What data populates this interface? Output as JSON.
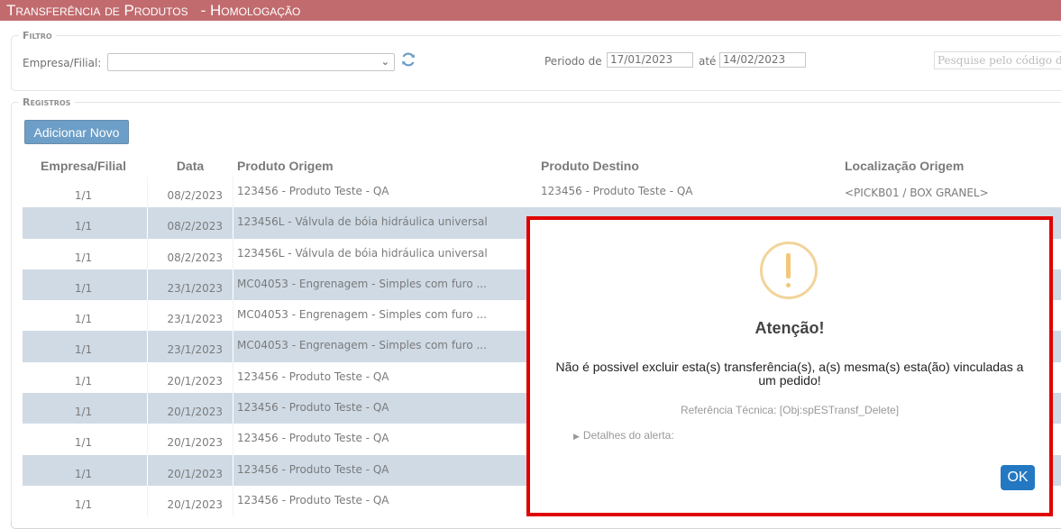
{
  "header": {
    "title": "Transferência de Produtos",
    "environment": "- Homologação"
  },
  "filtro": {
    "legend": "Filtro",
    "empresa_label": "Empresa/Filial:",
    "empresa_value": "",
    "periodo_label": "Periodo de",
    "periodo_start": "17/01/2023",
    "ate_label": "até",
    "periodo_end": "14/02/2023",
    "search_placeholder": "Pesquise pelo código d"
  },
  "registros": {
    "legend": "Registros",
    "add_button": "Adicionar Novo",
    "columns": [
      "Empresa/Filial",
      "Data",
      "Produto Origem",
      "Produto Destino",
      "Localização Origem"
    ],
    "rows": [
      {
        "empresa": "1/1",
        "data": "08/2/2023",
        "origem": "123456 - Produto Teste - QA",
        "destino": "123456 - Produto Teste - QA",
        "localizacao": "<PICKB01 / BOX GRANEL>"
      },
      {
        "empresa": "1/1",
        "data": "08/2/2023",
        "origem": "123456L - Válvula de bóia hidráulica universal",
        "destino": "",
        "localizacao": ""
      },
      {
        "empresa": "1/1",
        "data": "08/2/2023",
        "origem": "123456L - Válvula de bóia hidráulica universal",
        "destino": "",
        "localizacao": ""
      },
      {
        "empresa": "1/1",
        "data": "23/1/2023",
        "origem": "MC04053 - Engrenagem - Simples com furo ...",
        "destino": "",
        "localizacao": ""
      },
      {
        "empresa": "1/1",
        "data": "23/1/2023",
        "origem": "MC04053 - Engrenagem - Simples com furo ...",
        "destino": "",
        "localizacao": ""
      },
      {
        "empresa": "1/1",
        "data": "23/1/2023",
        "origem": "MC04053 - Engrenagem - Simples com furo ...",
        "destino": "",
        "localizacao": ""
      },
      {
        "empresa": "1/1",
        "data": "20/1/2023",
        "origem": "123456 - Produto Teste - QA",
        "destino": "",
        "localizacao": ""
      },
      {
        "empresa": "1/1",
        "data": "20/1/2023",
        "origem": "123456 - Produto Teste - QA",
        "destino": "",
        "localizacao": ""
      },
      {
        "empresa": "1/1",
        "data": "20/1/2023",
        "origem": "123456 - Produto Teste - QA",
        "destino": "",
        "localizacao": ""
      },
      {
        "empresa": "1/1",
        "data": "20/1/2023",
        "origem": "123456 - Produto Teste - QA",
        "destino": "",
        "localizacao": ""
      },
      {
        "empresa": "1/1",
        "data": "20/1/2023",
        "origem": "123456 - Produto Teste - QA",
        "destino": "",
        "localizacao": ""
      }
    ]
  },
  "modal": {
    "icon": "warning-icon",
    "title": "Atenção!",
    "message": "Não é possivel excluir esta(s) transferência(s), a(s) mesma(s) esta(ão) vinculadas a um pedido!",
    "reference": "Referência Técnica: [Obj:spESTransf_Delete]",
    "details_label": "Detalhes do alerta:",
    "ok_button": "OK"
  },
  "colors": {
    "header_bg": "#a01d22",
    "row_alt": "#b5c7d8",
    "primary_button": "#1f6ba9",
    "ok_button": "#2478c2",
    "modal_highlight": "#e00000",
    "warning": "#f2c879"
  }
}
